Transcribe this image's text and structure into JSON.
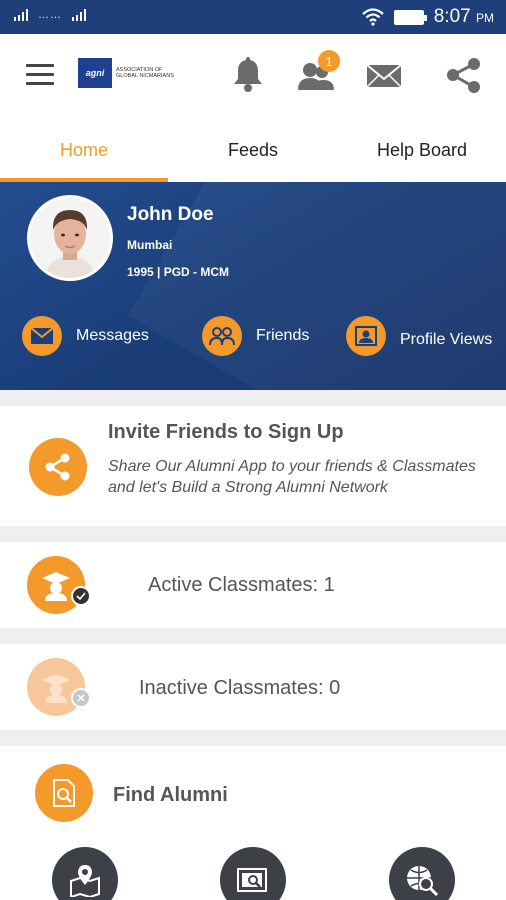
{
  "status_bar": {
    "signal": "……",
    "time": "8:07",
    "ampm": "PM"
  },
  "app_bar": {
    "logo_mark": "agni",
    "logo_text": "ASSOCIATION OF GLOBAL NICMARIANS",
    "notification_badge": "1"
  },
  "tabs": [
    {
      "label": "Home",
      "active": true
    },
    {
      "label": "Feeds",
      "active": false
    },
    {
      "label": "Help Board",
      "active": false
    }
  ],
  "profile": {
    "name": "John Doe",
    "city": "Mumbai",
    "batch": "1995 | PGD - MCM",
    "actions": [
      {
        "label": "Messages",
        "icon": "mail-icon"
      },
      {
        "label": "Friends",
        "icon": "friends-icon"
      },
      {
        "label": "Profile Views",
        "icon": "profile-card-icon"
      }
    ]
  },
  "invite": {
    "title": "Invite Friends to Sign Up",
    "description": "Share Our Alumni App to your friends & Classmates and let's Build a Strong Alumni Network"
  },
  "active_classmates": {
    "label": "Active Classmates: 1"
  },
  "inactive_classmates": {
    "label": "Inactive Classmates: 0"
  },
  "find_alumni": {
    "title": "Find Alumni",
    "options": [
      {
        "icon": "map-location-icon"
      },
      {
        "icon": "search-directory-icon"
      },
      {
        "icon": "globe-search-icon"
      }
    ]
  },
  "colors": {
    "accent": "#f39a2b",
    "header": "#1f3f7a",
    "dark": "#3d4046"
  }
}
